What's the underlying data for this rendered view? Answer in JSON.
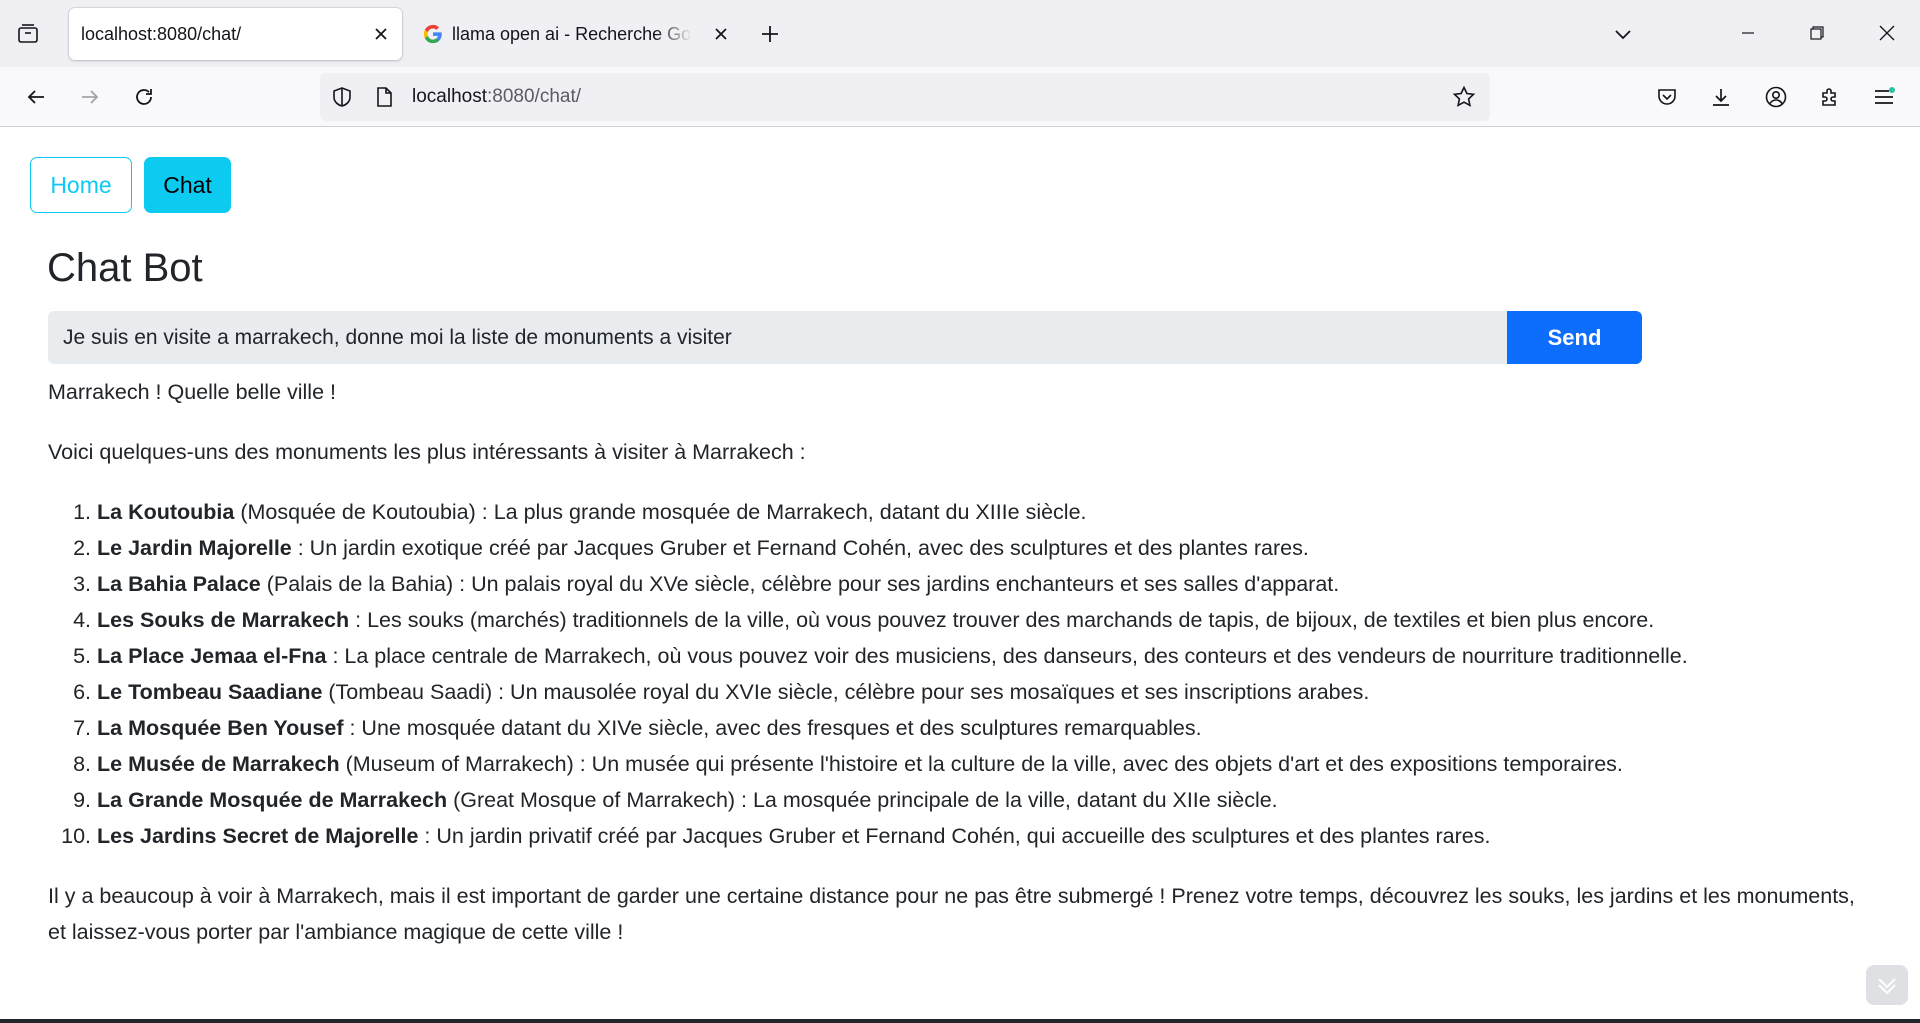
{
  "browser": {
    "tabs": [
      {
        "title": "localhost:8080/chat/",
        "active": true
      },
      {
        "title": "llama open ai - Recherche Google",
        "active": false
      }
    ],
    "url": {
      "host": "localhost",
      "rest": ":8080/chat/"
    },
    "icons": {
      "tab_overview": "tab-overview-icon",
      "close": "close-icon",
      "new_tab": "plus-icon",
      "list_tabs": "chevron-down-icon",
      "minimize": "minimize-icon",
      "restore": "restore-icon",
      "window_close": "window-close-icon",
      "back": "back-arrow-icon",
      "forward": "forward-arrow-icon",
      "reload": "reload-icon",
      "shield": "tracking-protection-shield-icon",
      "page": "page-info-icon",
      "bookmark": "bookmark-star-icon",
      "pocket": "pocket-icon",
      "downloads": "download-icon",
      "account": "account-icon",
      "extensions": "extensions-puzzle-icon",
      "menu": "hamburger-menu-icon"
    }
  },
  "nav": {
    "home_label": "Home",
    "chat_label": "Chat"
  },
  "chat": {
    "title": "Chat Bot",
    "input_value": "Je suis en visite a marrakech, donne moi la liste de monuments a visiter",
    "send_label": "Send"
  },
  "answer": {
    "intro1": "Marrakech ! Quelle belle ville !",
    "intro2": "Voici quelques-uns des monuments les plus intéressants à visiter à Marrakech :",
    "items": [
      {
        "name": "La Koutoubia",
        "rest": " (Mosquée de Koutoubia) : La plus grande mosquée de Marrakech, datant du XIIIe siècle."
      },
      {
        "name": "Le Jardin Majorelle",
        "rest": " : Un jardin exotique créé par Jacques Gruber et Fernand Cohén, avec des sculptures et des plantes rares."
      },
      {
        "name": "La Bahia Palace",
        "rest": " (Palais de la Bahia) : Un palais royal du XVe siècle, célèbre pour ses jardins enchanteurs et ses salles d'apparat."
      },
      {
        "name": "Les Souks de Marrakech",
        "rest": " : Les souks (marchés) traditionnels de la ville, où vous pouvez trouver des marchands de tapis, de bijoux, de textiles et bien plus encore."
      },
      {
        "name": "La Place Jemaa el-Fna",
        "rest": " : La place centrale de Marrakech, où vous pouvez voir des musiciens, des danseurs, des conteurs et des vendeurs de nourriture traditionnelle."
      },
      {
        "name": "Le Tombeau Saadiane",
        "rest": " (Tombeau Saadi) : Un mausolée royal du XVIe siècle, célèbre pour ses mosaïques et ses inscriptions arabes."
      },
      {
        "name": "La Mosquée Ben Yousef",
        "rest": " : Une mosquée datant du XIVe siècle, avec des fresques et des sculptures remarquables."
      },
      {
        "name": "Le Musée de Marrakech",
        "rest": " (Museum of Marrakech) : Un musée qui présente l'histoire et la culture de la ville, avec des objets d'art et des expositions temporaires."
      },
      {
        "name": "La Grande Mosquée de Marrakech",
        "rest": " (Great Mosque of Marrakech) : La mosquée principale de la ville, datant du XIIe siècle."
      },
      {
        "name": "Les Jardins Secret de Majorelle",
        "rest": " : Un jardin privatif créé par Jacques Gruber et Fernand Cohén, qui accueille des sculptures et des plantes rares."
      }
    ],
    "outro": "Il y a beaucoup à voir à Marrakech, mais il est important de garder une certaine distance pour ne pas être submergé ! Prenez votre temps, découvrez les souks, les jardins et les monuments, et laissez-vous porter par l'ambiance magique de cette ville !"
  },
  "colors": {
    "info": "#0dcaf0",
    "primary": "#0d6efd",
    "input_bg": "#e9ecef"
  }
}
